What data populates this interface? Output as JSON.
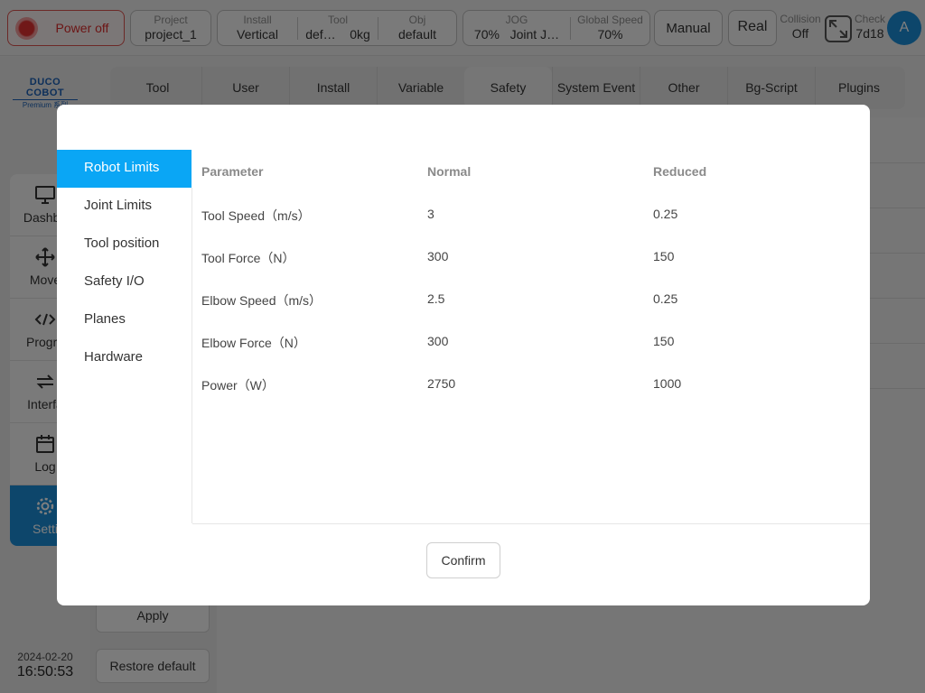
{
  "topbar": {
    "power_label": "Power off",
    "project": {
      "caption": "Project",
      "value": "project_1"
    },
    "install": {
      "caption": "Install",
      "value": "Vertical"
    },
    "tool": {
      "caption": "Tool",
      "value": "def…",
      "weight": "0kg"
    },
    "obj": {
      "caption": "Obj",
      "value": "default"
    },
    "jog": {
      "caption": "JOG",
      "value": "70%",
      "mode": "Joint J…"
    },
    "global_speed": {
      "caption": "Global Speed",
      "value": "70%"
    },
    "manual_label": "Manual",
    "real_label": "Real",
    "collision": {
      "caption": "Collision",
      "value": "Off"
    },
    "check": {
      "caption": "Check",
      "value": "7d18"
    },
    "avatar_letter": "A"
  },
  "sidebar": {
    "logo_line1": "DUCO COBOT",
    "logo_line2": "Premium 系列",
    "items": [
      {
        "label": "Dashbo",
        "icon": "monitor-icon"
      },
      {
        "label": "Move",
        "icon": "move-arrows-icon"
      },
      {
        "label": "Progra",
        "icon": "code-icon"
      },
      {
        "label": "Interfa",
        "icon": "swap-arrows-icon"
      },
      {
        "label": "Log",
        "icon": "calendar-icon"
      },
      {
        "label": "Setti",
        "icon": "gear-icon"
      }
    ],
    "date": "2024-02-20",
    "time": "16:50:53"
  },
  "tabs": [
    "Tool",
    "User",
    "Install",
    "Variable",
    "Safety",
    "System Event",
    "Other",
    "Bg-Script",
    "Plugins"
  ],
  "active_tab": "Safety",
  "background_buttons": {
    "apply": "Apply",
    "restore": "Restore default"
  },
  "modal": {
    "menu": [
      "Robot Limits",
      "Joint Limits",
      "Tool position",
      "Safety I/O",
      "Planes",
      "Hardware"
    ],
    "active_menu": "Robot Limits",
    "table": {
      "headers": [
        "Parameter",
        "Normal",
        "Reduced"
      ],
      "rows": [
        [
          "Tool Speed（m/s）",
          "3",
          "0.25"
        ],
        [
          "Tool Force（N）",
          "300",
          "150"
        ],
        [
          "Elbow Speed（m/s）",
          "2.5",
          "0.25"
        ],
        [
          "Elbow Force（N）",
          "300",
          "150"
        ],
        [
          "Power（W）",
          "2750",
          "1000"
        ]
      ]
    },
    "confirm_label": "Confirm"
  },
  "colors": {
    "accent": "#0aa6f5",
    "nav_active": "#1b8cd6",
    "power_red": "#d82a2a"
  }
}
